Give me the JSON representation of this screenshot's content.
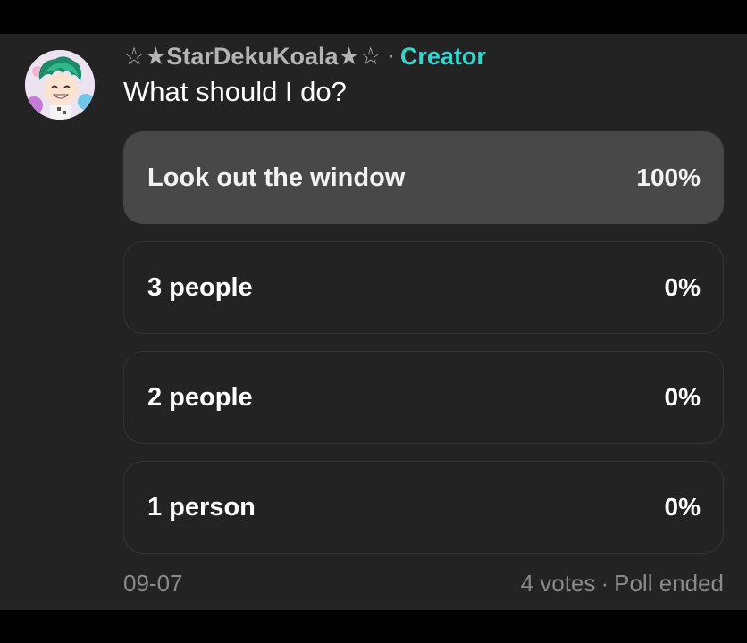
{
  "post": {
    "author": "☆★StarDekuKoala★☆",
    "separator": "·",
    "role": "Creator",
    "question": "What should I do?"
  },
  "poll": {
    "options": [
      {
        "label": "Look out the window",
        "percent_text": "100%",
        "share": 1.0
      },
      {
        "label": "3 people",
        "percent_text": "0%",
        "share": 0.0
      },
      {
        "label": "2 people",
        "percent_text": "0%",
        "share": 0.0
      },
      {
        "label": "1 person",
        "percent_text": "0%",
        "share": 0.0
      }
    ],
    "votes": "4 votes",
    "dot": "·",
    "status": "Poll ended",
    "date": "09-07"
  },
  "colors": {
    "background": "#232323",
    "accent": "#31d6cf",
    "fill": "#484848"
  },
  "icons": {
    "avatar": "avatar-image"
  }
}
